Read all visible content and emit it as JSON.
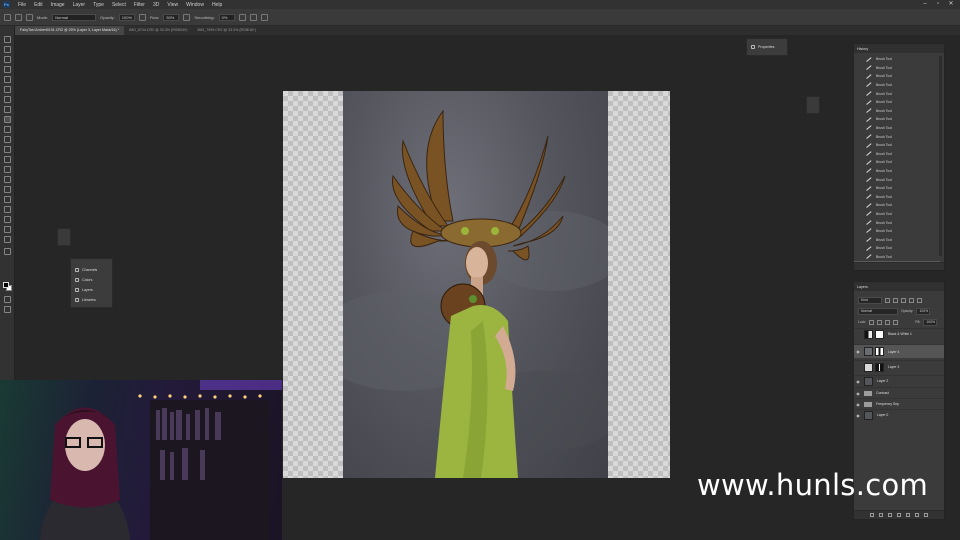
{
  "app": {
    "logo": "Ps",
    "menu": [
      "File",
      "Edit",
      "Image",
      "Layer",
      "Type",
      "Select",
      "Filter",
      "3D",
      "View",
      "Window",
      "Help"
    ],
    "window_controls": [
      "minimize-icon",
      "maximize-icon",
      "close-icon"
    ]
  },
  "options_bar": {
    "mode_label": "Mode:",
    "mode_value": "Normal",
    "opacity_label": "Opacity:",
    "opacity_value": "100%",
    "flow_label": "Flow:",
    "flow_value": "50%",
    "smoothing_label": "Smoothing:",
    "smoothing_value": "0%"
  },
  "tabs": [
    {
      "label": "FairyTaxi Ambert0191.CR2 @ 25% (Layer 3, Layer Mask/16) *",
      "active": true
    },
    {
      "label": "IMG_8744.CR2 @ 33.3% (RGB/16*)",
      "active": false
    },
    {
      "label": "IMG_7999.CR2 @ 33.3% (RGB/16*)",
      "active": false
    }
  ],
  "properties_panel": {
    "title": "Properties"
  },
  "mini_panel": {
    "items": [
      {
        "label": "Channels",
        "icon": "channels-icon"
      },
      {
        "label": "Colors",
        "icon": "colors-icon"
      },
      {
        "label": "Layers",
        "icon": "layers-icon"
      },
      {
        "label": "Libraries",
        "icon": "libraries-icon"
      }
    ]
  },
  "history": {
    "title": "History",
    "items": [
      "Brush Tool",
      "Brush Tool",
      "Brush Tool",
      "Brush Tool",
      "Brush Tool",
      "Brush Tool",
      "Brush Tool",
      "Brush Tool",
      "Brush Tool",
      "Brush Tool",
      "Brush Tool",
      "Brush Tool",
      "Brush Tool",
      "Brush Tool",
      "Brush Tool",
      "Brush Tool",
      "Brush Tool",
      "Brush Tool",
      "Brush Tool",
      "Brush Tool",
      "Brush Tool",
      "Brush Tool",
      "Brush Tool",
      "Brush Tool",
      "Brush Tool"
    ]
  },
  "layers": {
    "title": "Layers",
    "kind": "Kind",
    "blend": "Normal",
    "opacity_label": "Opacity:",
    "opacity_value": "100%",
    "lock_label": "Lock:",
    "fill_label": "Fill:",
    "fill_value": "100%",
    "rows": [
      {
        "name": "Black & White 1",
        "type": "adjustment",
        "visible": false,
        "selected": false
      },
      {
        "name": "Layer 4",
        "type": "masked",
        "visible": true,
        "selected": true
      },
      {
        "name": "Layer 3",
        "type": "masked",
        "visible": false,
        "selected": false
      },
      {
        "name": "Layer 2",
        "type": "pixel",
        "visible": true,
        "selected": false
      },
      {
        "name": "Contrast",
        "type": "group",
        "visible": true,
        "selected": false
      },
      {
        "name": "Frequency Sep",
        "type": "group",
        "visible": true,
        "selected": false
      },
      {
        "name": "Layer 0",
        "type": "pixel",
        "visible": true,
        "selected": false
      }
    ]
  },
  "watermark": "www.hunls.com"
}
